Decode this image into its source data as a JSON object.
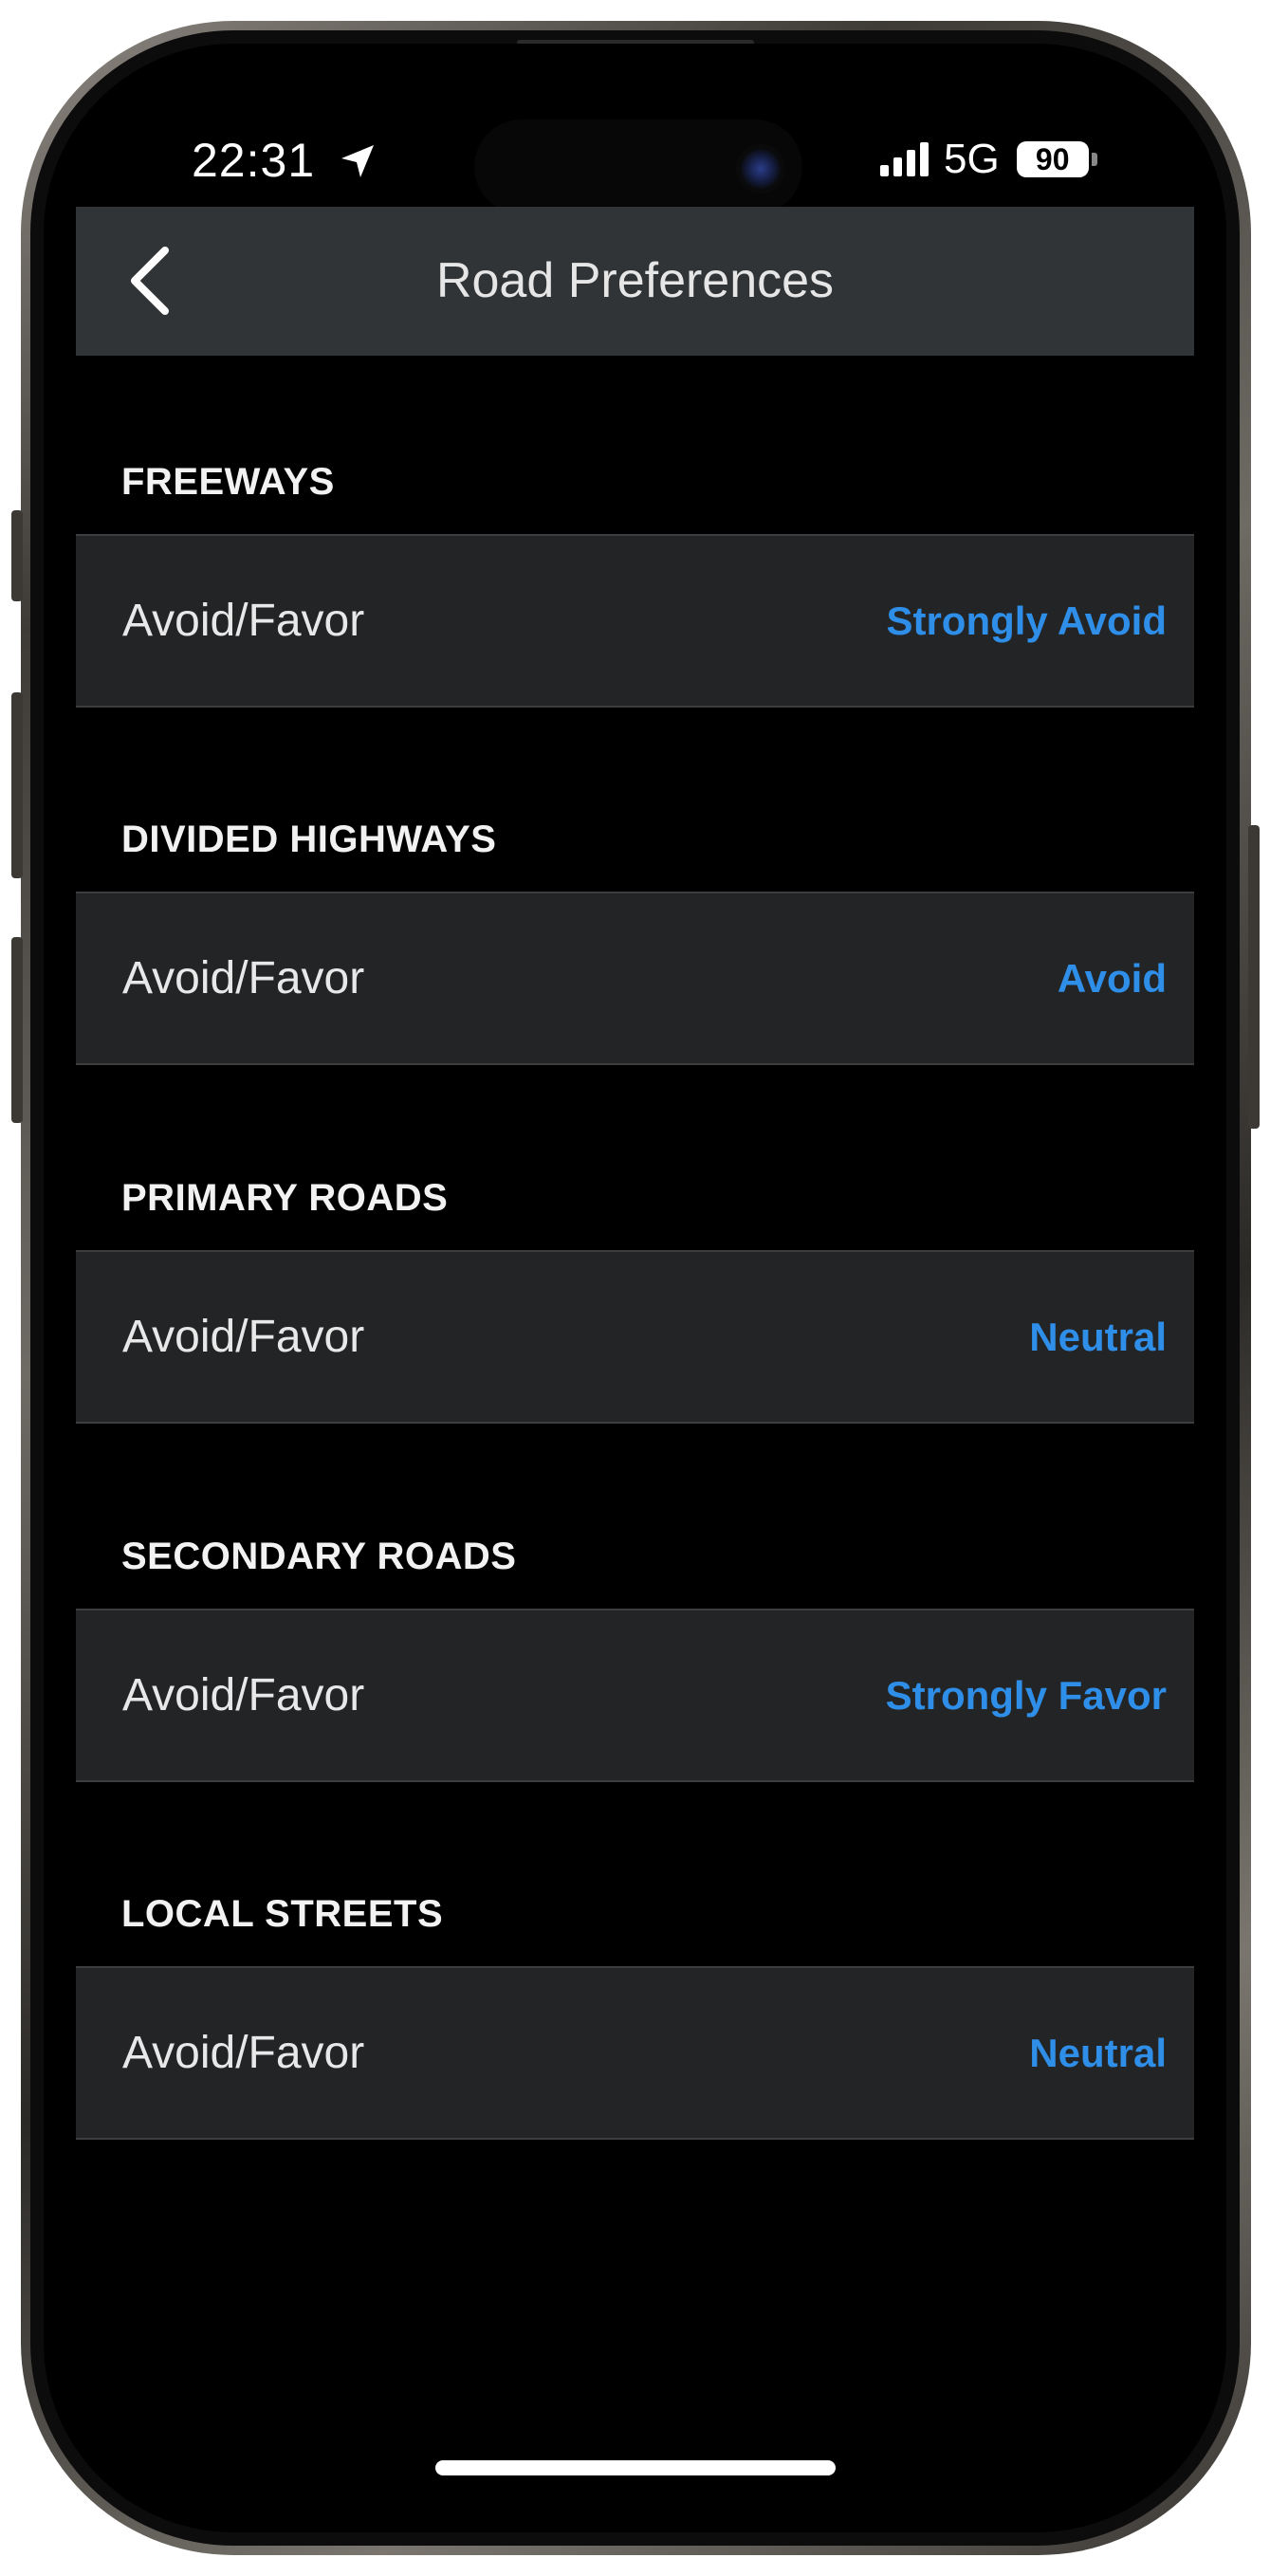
{
  "status_bar": {
    "time": "22:31",
    "network": "5G",
    "battery": "90"
  },
  "nav": {
    "title": "Road Preferences",
    "back_icon": "chevron-left-icon"
  },
  "sections": [
    {
      "header": "FREEWAYS",
      "label": "Avoid/Favor",
      "value": "Strongly Avoid"
    },
    {
      "header": "DIVIDED HIGHWAYS",
      "label": "Avoid/Favor",
      "value": "Avoid"
    },
    {
      "header": "PRIMARY ROADS",
      "label": "Avoid/Favor",
      "value": "Neutral"
    },
    {
      "header": "SECONDARY ROADS",
      "label": "Avoid/Favor",
      "value": "Strongly Favor"
    },
    {
      "header": "LOCAL STREETS",
      "label": "Avoid/Favor",
      "value": "Neutral"
    }
  ],
  "colors": {
    "accent": "#2e8ee8",
    "background": "#000000",
    "row_background": "#222426",
    "navbar_background": "#313436"
  }
}
